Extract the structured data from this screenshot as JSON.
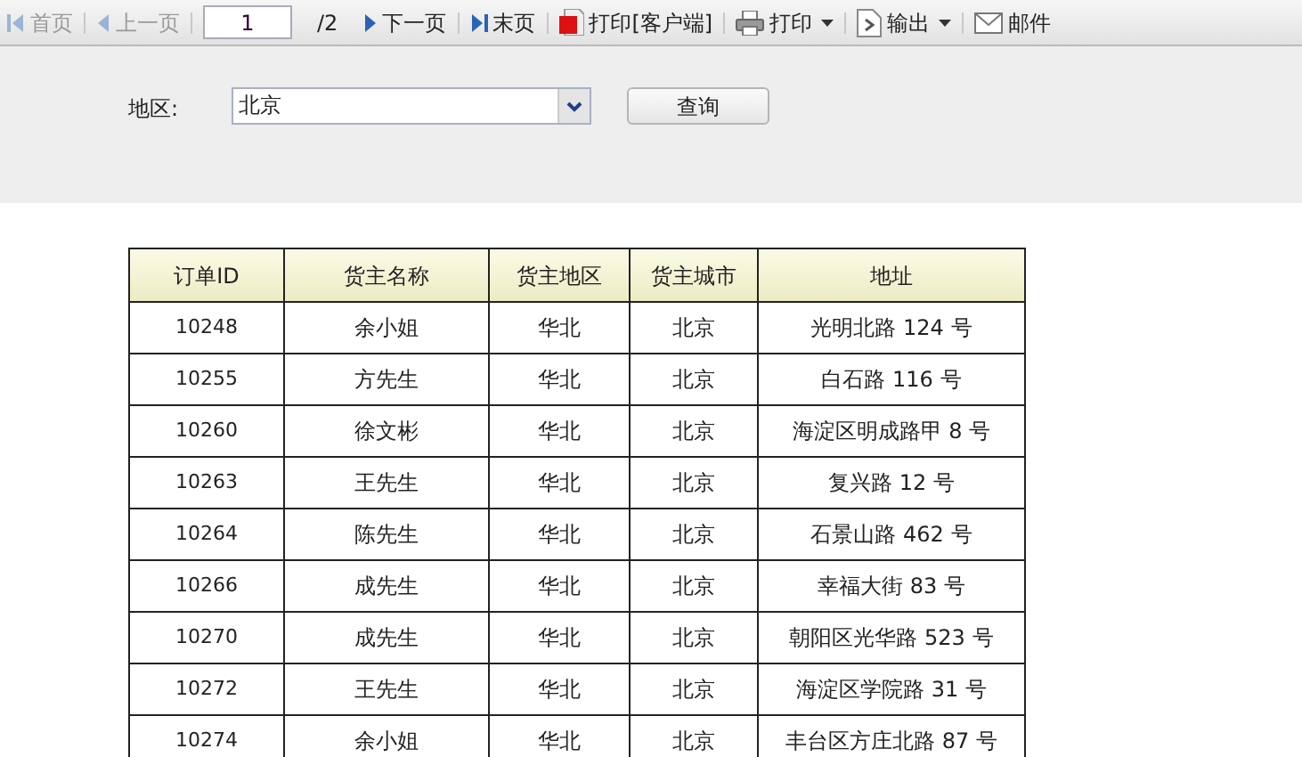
{
  "toolbar": {
    "items": [
      {
        "kind": "first",
        "label": "首页",
        "disabled": true
      },
      {
        "kind": "prev",
        "label": "上一页",
        "disabled": true
      },
      {
        "kind": "page",
        "value": "1",
        "total": "/2"
      },
      {
        "kind": "next",
        "label": "下一页",
        "disabled": false
      },
      {
        "kind": "last",
        "label": "末页",
        "disabled": false
      },
      {
        "kind": "flash",
        "label": "打印[客户端]",
        "disabled": false
      },
      {
        "kind": "print",
        "label": "打印",
        "disabled": false,
        "dropdown": true
      },
      {
        "kind": "export",
        "label": "输出",
        "disabled": false,
        "dropdown": true
      },
      {
        "kind": "mail",
        "label": "邮件",
        "disabled": false
      }
    ]
  },
  "filter": {
    "label": "地区:",
    "region": "北京",
    "query_button": "查询"
  },
  "table": {
    "columns": [
      "订单ID",
      "货主名称",
      "货主地区",
      "货主城市",
      "地址"
    ],
    "rows": [
      [
        "10248",
        "余小姐",
        "华北",
        "北京",
        "光明北路 124 号"
      ],
      [
        "10255",
        "方先生",
        "华北",
        "北京",
        "白石路 116 号"
      ],
      [
        "10260",
        "徐文彬",
        "华北",
        "北京",
        "海淀区明成路甲 8 号"
      ],
      [
        "10263",
        "王先生",
        "华北",
        "北京",
        "复兴路 12 号"
      ],
      [
        "10264",
        "陈先生",
        "华北",
        "北京",
        "石景山路 462 号"
      ],
      [
        "10266",
        "成先生",
        "华北",
        "北京",
        "幸福大街 83 号"
      ],
      [
        "10270",
        "成先生",
        "华北",
        "北京",
        "朝阳区光华路 523 号"
      ],
      [
        "10272",
        "王先生",
        "华北",
        "北京",
        "海淀区学院路 31 号"
      ],
      [
        "10274",
        "余小姐",
        "华北",
        "北京",
        "丰台区方庄北路 87 号"
      ]
    ]
  }
}
